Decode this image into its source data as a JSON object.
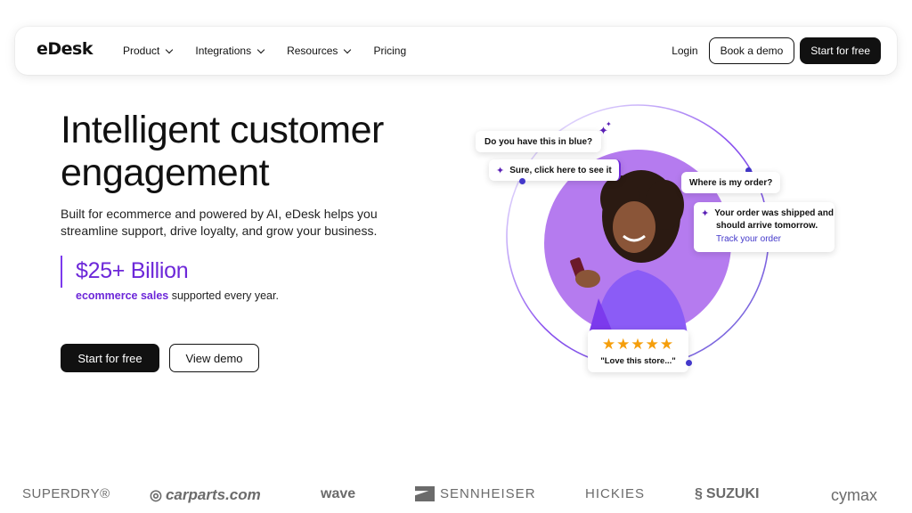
{
  "nav": {
    "logo_text": "eDesk",
    "menu": [
      {
        "label": "Product",
        "has_dropdown": true
      },
      {
        "label": "Integrations",
        "has_dropdown": true
      },
      {
        "label": "Resources",
        "has_dropdown": true
      },
      {
        "label": "Pricing",
        "has_dropdown": false
      }
    ],
    "login": "Login",
    "book_demo": "Book a demo",
    "start_free": "Start for free"
  },
  "hero": {
    "headline": "Intelligent customer engagement",
    "subtext": "Built for ecommerce and powered by AI, eDesk helps you streamline support, drive loyalty, and grow your business.",
    "stat_value": "$25+ Billion",
    "stat_caption_highlight": "ecommerce sales",
    "stat_caption_rest": " supported every year.",
    "cta_primary": "Start for free",
    "cta_secondary": "View demo"
  },
  "illustration": {
    "q_blue": "Do you have this in blue?",
    "a_blue": "Sure, click here to see it",
    "q_order": "Where is my order?",
    "a_order_line1": "Your order was shipped and",
    "a_order_line2": "should arrive tomorrow.",
    "a_order_link": "Track your order",
    "rating": 5,
    "review": "\"Love this store...\""
  },
  "brands": [
    "SUPERDRY®",
    "carparts.com",
    "wave",
    "SENNHEISER",
    "HICKIES",
    "SUZUKI",
    "cymax"
  ],
  "colors": {
    "accent": "#6d28d9",
    "dark": "#111111",
    "circle": "#b57bef",
    "star": "#f59e0b",
    "brand_gray": "#6b6b6b"
  }
}
